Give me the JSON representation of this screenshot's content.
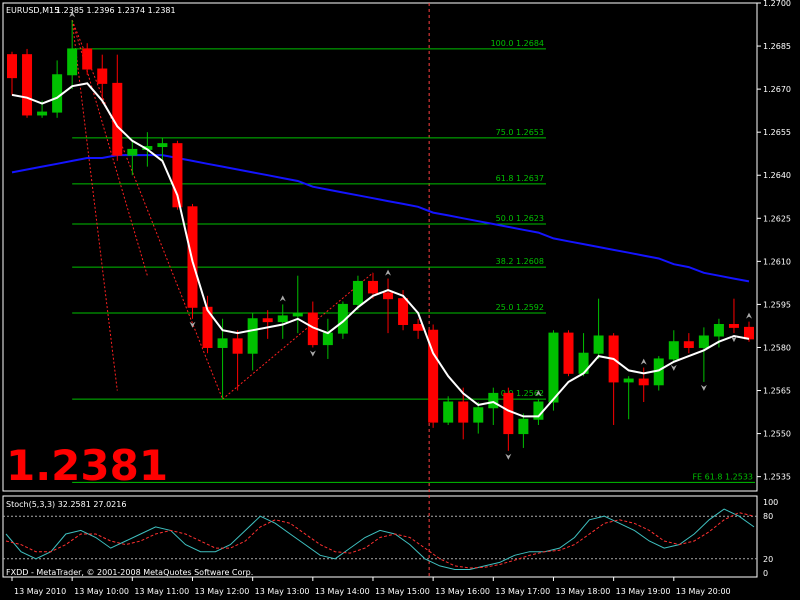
{
  "header": {
    "symbol": "EURUSD,M15",
    "ohlc": "1.2385 1.2396 1.2374 1.2381"
  },
  "big_price": "1.2381",
  "indicator": {
    "label": "Stoch(5,3,3) 32.2581 27.0216",
    "levels": [
      100,
      80,
      20,
      0
    ]
  },
  "copyright": "FXDD - MetaTrader, © 2001-2008 MetaQuotes Software Corp.",
  "colors": {
    "background": "#000000",
    "grid": "#ffffff",
    "bull": "#00c000",
    "bear": "#ff0000",
    "ma_fast": "#ffffff",
    "ma_slow": "#1414ff",
    "fib": "#00c000",
    "stoch_main": "#3fc0c0",
    "stoch_signal": "#ff3030",
    "big_price": "#ff0000"
  },
  "chart_data": {
    "type": "candlestick",
    "symbol": "EURUSD",
    "timeframe": "M15",
    "ylim": [
      1.253,
      1.27
    ],
    "y_ticks": [
      1.27,
      1.2685,
      1.267,
      1.2655,
      1.264,
      1.2625,
      1.261,
      1.2595,
      1.258,
      1.2565,
      1.255,
      1.2535
    ],
    "x_labels": [
      "13 May 2010",
      "13 May 10:00",
      "13 May 11:00",
      "13 May 12:00",
      "13 May 13:00",
      "13 May 14:00",
      "13 May 15:00",
      "13 May 16:00",
      "13 May 17:00",
      "13 May 18:00",
      "13 May 19:00",
      "13 May 20:00"
    ],
    "candles": [
      {
        "o": 1.2682,
        "h": 1.2683,
        "l": 1.2668,
        "c": 1.2674
      },
      {
        "o": 1.2682,
        "h": 1.2684,
        "l": 1.266,
        "c": 1.2661
      },
      {
        "o": 1.2661,
        "h": 1.2666,
        "l": 1.266,
        "c": 1.2662
      },
      {
        "o": 1.2662,
        "h": 1.268,
        "l": 1.266,
        "c": 1.2675
      },
      {
        "o": 1.2675,
        "h": 1.2694,
        "l": 1.267,
        "c": 1.2684
      },
      {
        "o": 1.2684,
        "h": 1.2686,
        "l": 1.2675,
        "c": 1.2677
      },
      {
        "o": 1.2677,
        "h": 1.2682,
        "l": 1.2665,
        "c": 1.2672
      },
      {
        "o": 1.2672,
        "h": 1.2682,
        "l": 1.2645,
        "c": 1.2647
      },
      {
        "o": 1.2647,
        "h": 1.2652,
        "l": 1.264,
        "c": 1.2649
      },
      {
        "o": 1.2649,
        "h": 1.2655,
        "l": 1.2643,
        "c": 1.265
      },
      {
        "o": 1.265,
        "h": 1.2653,
        "l": 1.2645,
        "c": 1.2651
      },
      {
        "o": 1.2651,
        "h": 1.2652,
        "l": 1.2628,
        "c": 1.2629
      },
      {
        "o": 1.2629,
        "h": 1.263,
        "l": 1.259,
        "c": 1.2594
      },
      {
        "o": 1.2594,
        "h": 1.2598,
        "l": 1.2578,
        "c": 1.258
      },
      {
        "o": 1.258,
        "h": 1.259,
        "l": 1.2562,
        "c": 1.2583
      },
      {
        "o": 1.2583,
        "h": 1.2586,
        "l": 1.2565,
        "c": 1.2578
      },
      {
        "o": 1.2578,
        "h": 1.2592,
        "l": 1.2572,
        "c": 1.259
      },
      {
        "o": 1.259,
        "h": 1.2593,
        "l": 1.2583,
        "c": 1.2589
      },
      {
        "o": 1.2589,
        "h": 1.2595,
        "l": 1.2583,
        "c": 1.2591
      },
      {
        "o": 1.2591,
        "h": 1.2605,
        "l": 1.2585,
        "c": 1.2592
      },
      {
        "o": 1.2592,
        "h": 1.2596,
        "l": 1.258,
        "c": 1.2581
      },
      {
        "o": 1.2581,
        "h": 1.259,
        "l": 1.2576,
        "c": 1.2585
      },
      {
        "o": 1.2585,
        "h": 1.2596,
        "l": 1.2583,
        "c": 1.2595
      },
      {
        "o": 1.2595,
        "h": 1.2605,
        "l": 1.2593,
        "c": 1.2603
      },
      {
        "o": 1.2603,
        "h": 1.2606,
        "l": 1.2597,
        "c": 1.2599
      },
      {
        "o": 1.2599,
        "h": 1.2604,
        "l": 1.2585,
        "c": 1.2597
      },
      {
        "o": 1.2597,
        "h": 1.26,
        "l": 1.2586,
        "c": 1.2588
      },
      {
        "o": 1.2588,
        "h": 1.259,
        "l": 1.2583,
        "c": 1.2586
      },
      {
        "o": 1.2586,
        "h": 1.2588,
        "l": 1.2552,
        "c": 1.2554
      },
      {
        "o": 1.2554,
        "h": 1.2563,
        "l": 1.2553,
        "c": 1.2561
      },
      {
        "o": 1.2561,
        "h": 1.2566,
        "l": 1.2548,
        "c": 1.2554
      },
      {
        "o": 1.2554,
        "h": 1.2561,
        "l": 1.255,
        "c": 1.2559
      },
      {
        "o": 1.2559,
        "h": 1.2566,
        "l": 1.2553,
        "c": 1.2564
      },
      {
        "o": 1.2564,
        "h": 1.2566,
        "l": 1.2544,
        "c": 1.255
      },
      {
        "o": 1.255,
        "h": 1.2557,
        "l": 1.2545,
        "c": 1.2555
      },
      {
        "o": 1.2555,
        "h": 1.2562,
        "l": 1.2553,
        "c": 1.2561
      },
      {
        "o": 1.2561,
        "h": 1.2586,
        "l": 1.2558,
        "c": 1.2585
      },
      {
        "o": 1.2585,
        "h": 1.2586,
        "l": 1.257,
        "c": 1.2571
      },
      {
        "o": 1.2571,
        "h": 1.2585,
        "l": 1.257,
        "c": 1.2578
      },
      {
        "o": 1.2578,
        "h": 1.2597,
        "l": 1.2576,
        "c": 1.2584
      },
      {
        "o": 1.2584,
        "h": 1.2585,
        "l": 1.2553,
        "c": 1.2568
      },
      {
        "o": 1.2568,
        "h": 1.257,
        "l": 1.2555,
        "c": 1.2569
      },
      {
        "o": 1.2569,
        "h": 1.2573,
        "l": 1.2561,
        "c": 1.2567
      },
      {
        "o": 1.2567,
        "h": 1.2577,
        "l": 1.2565,
        "c": 1.2576
      },
      {
        "o": 1.2576,
        "h": 1.2586,
        "l": 1.2575,
        "c": 1.2582
      },
      {
        "o": 1.2582,
        "h": 1.2585,
        "l": 1.2578,
        "c": 1.258
      },
      {
        "o": 1.258,
        "h": 1.2587,
        "l": 1.2568,
        "c": 1.2584
      },
      {
        "o": 1.2584,
        "h": 1.259,
        "l": 1.258,
        "c": 1.2588
      },
      {
        "o": 1.2588,
        "h": 1.2597,
        "l": 1.2585,
        "c": 1.2587
      },
      {
        "o": 1.2587,
        "h": 1.2589,
        "l": 1.2582,
        "c": 1.2583
      }
    ],
    "ma_fast": [
      1.2668,
      1.2667,
      1.2665,
      1.2667,
      1.2671,
      1.2672,
      1.2666,
      1.2657,
      1.2652,
      1.2649,
      1.2645,
      1.2633,
      1.261,
      1.2593,
      1.2586,
      1.2585,
      1.2586,
      1.2587,
      1.2588,
      1.259,
      1.2587,
      1.2585,
      1.2589,
      1.2594,
      1.2598,
      1.26,
      1.2598,
      1.2592,
      1.2578,
      1.257,
      1.2564,
      1.256,
      1.2561,
      1.2558,
      1.2556,
      1.2556,
      1.2562,
      1.2568,
      1.2571,
      1.2577,
      1.2576,
      1.2572,
      1.2571,
      1.2572,
      1.2575,
      1.2577,
      1.2579,
      1.2582,
      1.2584,
      1.2583
    ],
    "ma_slow": [
      1.2641,
      1.2642,
      1.2643,
      1.2644,
      1.2645,
      1.2646,
      1.2646,
      1.2647,
      1.2647,
      1.2647,
      1.2647,
      1.2646,
      1.2645,
      1.2644,
      1.2643,
      1.2642,
      1.2641,
      1.264,
      1.2639,
      1.2638,
      1.2636,
      1.2635,
      1.2634,
      1.2633,
      1.2632,
      1.2631,
      1.263,
      1.2629,
      1.2627,
      1.2626,
      1.2625,
      1.2624,
      1.2623,
      1.2622,
      1.2621,
      1.262,
      1.2618,
      1.2617,
      1.2616,
      1.2615,
      1.2614,
      1.2613,
      1.2612,
      1.2611,
      1.2609,
      1.2608,
      1.2606,
      1.2605,
      1.2604,
      1.2603
    ],
    "fib_levels": [
      {
        "label": "100.0 1.2684",
        "price": 1.2684
      },
      {
        "label": "75.0 1.2653",
        "price": 1.2653
      },
      {
        "label": "61.8 1.2637",
        "price": 1.2637
      },
      {
        "label": "50.0 1.2623",
        "price": 1.2623
      },
      {
        "label": "38.2 1.2608",
        "price": 1.2608
      },
      {
        "label": "25.0 1.2592",
        "price": 1.2592
      },
      {
        "label": "0.0 1.2562",
        "price": 1.2562
      }
    ],
    "fe_level": {
      "label": "FE 61.8 1.2533",
      "price": 1.2533
    },
    "fractals_up": [
      4,
      18,
      25,
      35,
      42,
      49
    ],
    "fractals_down": [
      12,
      20,
      33,
      44,
      46,
      48
    ],
    "stoch_main": [
      55,
      30,
      20,
      30,
      55,
      60,
      50,
      35,
      45,
      55,
      65,
      60,
      40,
      30,
      30,
      40,
      60,
      80,
      70,
      55,
      40,
      25,
      20,
      35,
      50,
      60,
      55,
      40,
      20,
      10,
      5,
      5,
      10,
      15,
      25,
      30,
      30,
      35,
      50,
      75,
      80,
      70,
      60,
      45,
      35,
      40,
      55,
      75,
      90,
      80,
      65
    ],
    "stoch_signal": [
      45,
      40,
      30,
      30,
      40,
      55,
      55,
      45,
      40,
      45,
      55,
      60,
      55,
      45,
      35,
      35,
      45,
      65,
      75,
      70,
      55,
      40,
      30,
      28,
      35,
      50,
      55,
      50,
      35,
      20,
      10,
      7,
      8,
      12,
      18,
      25,
      30,
      32,
      40,
      55,
      70,
      75,
      70,
      60,
      45,
      40,
      45,
      58,
      75,
      85,
      80
    ]
  }
}
